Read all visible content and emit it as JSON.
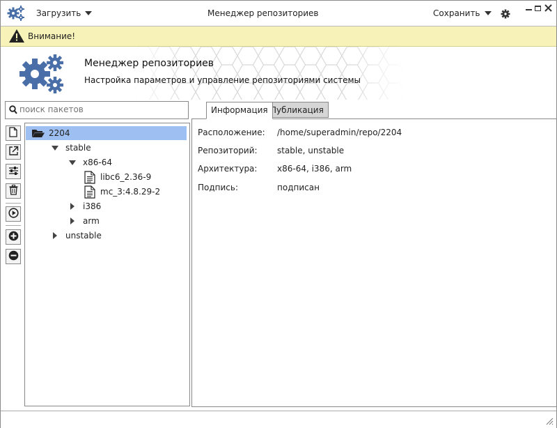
{
  "titlebar": {
    "load_label": "Загрузить",
    "title": "Менеджер репозиториев",
    "save_label": "Сохранить",
    "app_icon": "gears-icon",
    "settings_icon": "gear-icon"
  },
  "warning": {
    "text": "Внимание!",
    "icon": "warning-icon"
  },
  "header": {
    "title": "Менеджер репозиториев",
    "subtitle": "Настройка параметров и управление репозиториями системы",
    "icon": "gears-icon"
  },
  "search": {
    "placeholder": "поиск пакетов"
  },
  "toolbar": {
    "buttons": [
      "new-file-icon",
      "export-icon",
      "settings-sliders-icon",
      "trash-icon",
      "play-icon",
      "add-icon",
      "remove-icon"
    ]
  },
  "tree": {
    "root": "2204",
    "stable": "stable",
    "x86": "x86-64",
    "pkg1": "libc6_2.36-9",
    "pkg2": "mc_3:4.8.29-2",
    "i386": "i386",
    "arm": "arm",
    "unstable": "unstable"
  },
  "tabs": {
    "info": "Информация",
    "publish": "Публикация"
  },
  "info": {
    "location_label": "Расположение:",
    "location_value": "/home/superadmin/repo/2204",
    "repo_label": "Репозиторий:",
    "repo_value": "stable, unstable",
    "arch_label": "Архитектура:",
    "arch_value": "x86-64, i386, arm",
    "sign_label": "Подпись:",
    "sign_value": "подписан"
  },
  "colors": {
    "accent": "#4a6fa8",
    "selection": "#9dbff2",
    "warning_bg": "#f7f2b7"
  }
}
